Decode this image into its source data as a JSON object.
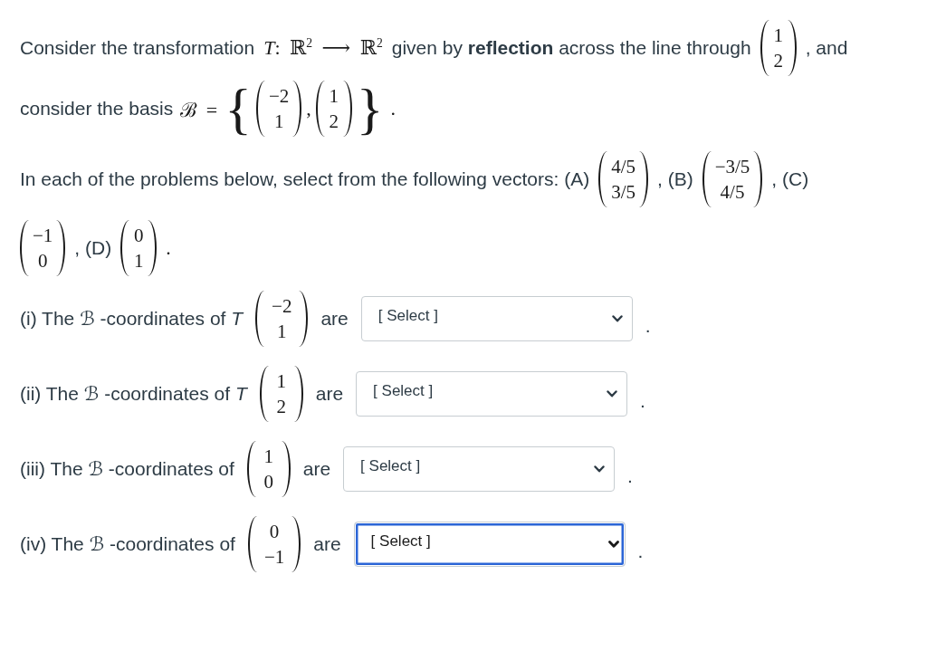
{
  "intro": {
    "lines": [
      {
        "parts": [
          {
            "kind": "text",
            "text": "Consider the transformation"
          },
          {
            "kind": "math",
            "text": "*T*: ℝ$^{2}$ ⟶ ℝ$^{2}$"
          },
          {
            "kind": "text",
            "text": "given by **reflection** across the line through"
          },
          {
            "kind": "vector",
            "entries": [
              "1",
              "2"
            ]
          },
          {
            "kind": "text",
            "text": ", and"
          }
        ]
      },
      {
        "parts": [
          {
            "kind": "text",
            "text": "consider the basis"
          },
          {
            "kind": "math",
            "text": "ℬ ="
          },
          {
            "kind": "set",
            "open": "{",
            "close": "}",
            "parts": [
              {
                "kind": "vector",
                "entries": [
                  "−2",
                  "1"
                ]
              },
              {
                "kind": "math",
                "text": ","
              },
              {
                "kind": "vector",
                "entries": [
                  "1",
                  "2"
                ]
              }
            ]
          },
          {
            "kind": "math",
            "text": "."
          }
        ]
      }
    ]
  },
  "instructions": {
    "lines": [
      {
        "parts": [
          {
            "kind": "text",
            "text": "In each of the problems below, select from the following vectors: (A)"
          },
          {
            "kind": "vector",
            "entries": [
              "4/5",
              "3/5"
            ]
          },
          {
            "kind": "text",
            "text": ", (B)"
          },
          {
            "kind": "vector",
            "entries": [
              "−3/5",
              "4/5"
            ]
          },
          {
            "kind": "text",
            "text": ", (C)"
          }
        ]
      },
      {
        "parts": [
          {
            "kind": "vector",
            "entries": [
              "−1",
              "0"
            ]
          },
          {
            "kind": "text",
            "text": ", (D)"
          },
          {
            "kind": "vector",
            "entries": [
              "0",
              "1"
            ]
          },
          {
            "kind": "math",
            "text": "."
          }
        ]
      }
    ]
  },
  "questions": [
    {
      "parts": [
        {
          "kind": "text",
          "text": "(i) The *ℬ* -coordinates of *T*"
        },
        {
          "kind": "vector",
          "entries": [
            "−2",
            "1"
          ]
        },
        {
          "kind": "text",
          "text": "are"
        },
        {
          "kind": "select",
          "placeholder": "[ Select ]",
          "focused": false
        },
        {
          "kind": "punctuation",
          "text": "."
        }
      ]
    },
    {
      "parts": [
        {
          "kind": "text",
          "text": "(ii) The *ℬ* -coordinates of *T*"
        },
        {
          "kind": "vector",
          "entries": [
            "1",
            "2"
          ]
        },
        {
          "kind": "text",
          "text": "are"
        },
        {
          "kind": "select",
          "placeholder": "[ Select ]",
          "focused": false
        },
        {
          "kind": "punctuation",
          "text": "."
        }
      ]
    },
    {
      "parts": [
        {
          "kind": "text",
          "text": "(iii) The *ℬ* -coordinates of"
        },
        {
          "kind": "vector",
          "entries": [
            "1",
            "0"
          ]
        },
        {
          "kind": "text",
          "text": "are"
        },
        {
          "kind": "select",
          "placeholder": "[ Select ]",
          "focused": false
        },
        {
          "kind": "punctuation",
          "text": "."
        }
      ]
    },
    {
      "parts": [
        {
          "kind": "text",
          "text": "(iv) The *ℬ* -coordinates of"
        },
        {
          "kind": "vector",
          "entries": [
            "0",
            "−1"
          ]
        },
        {
          "kind": "text",
          "text": "are"
        },
        {
          "kind": "select",
          "placeholder": "[ Select ]",
          "focused": true
        },
        {
          "kind": "punctuation",
          "text": "."
        }
      ]
    }
  ]
}
